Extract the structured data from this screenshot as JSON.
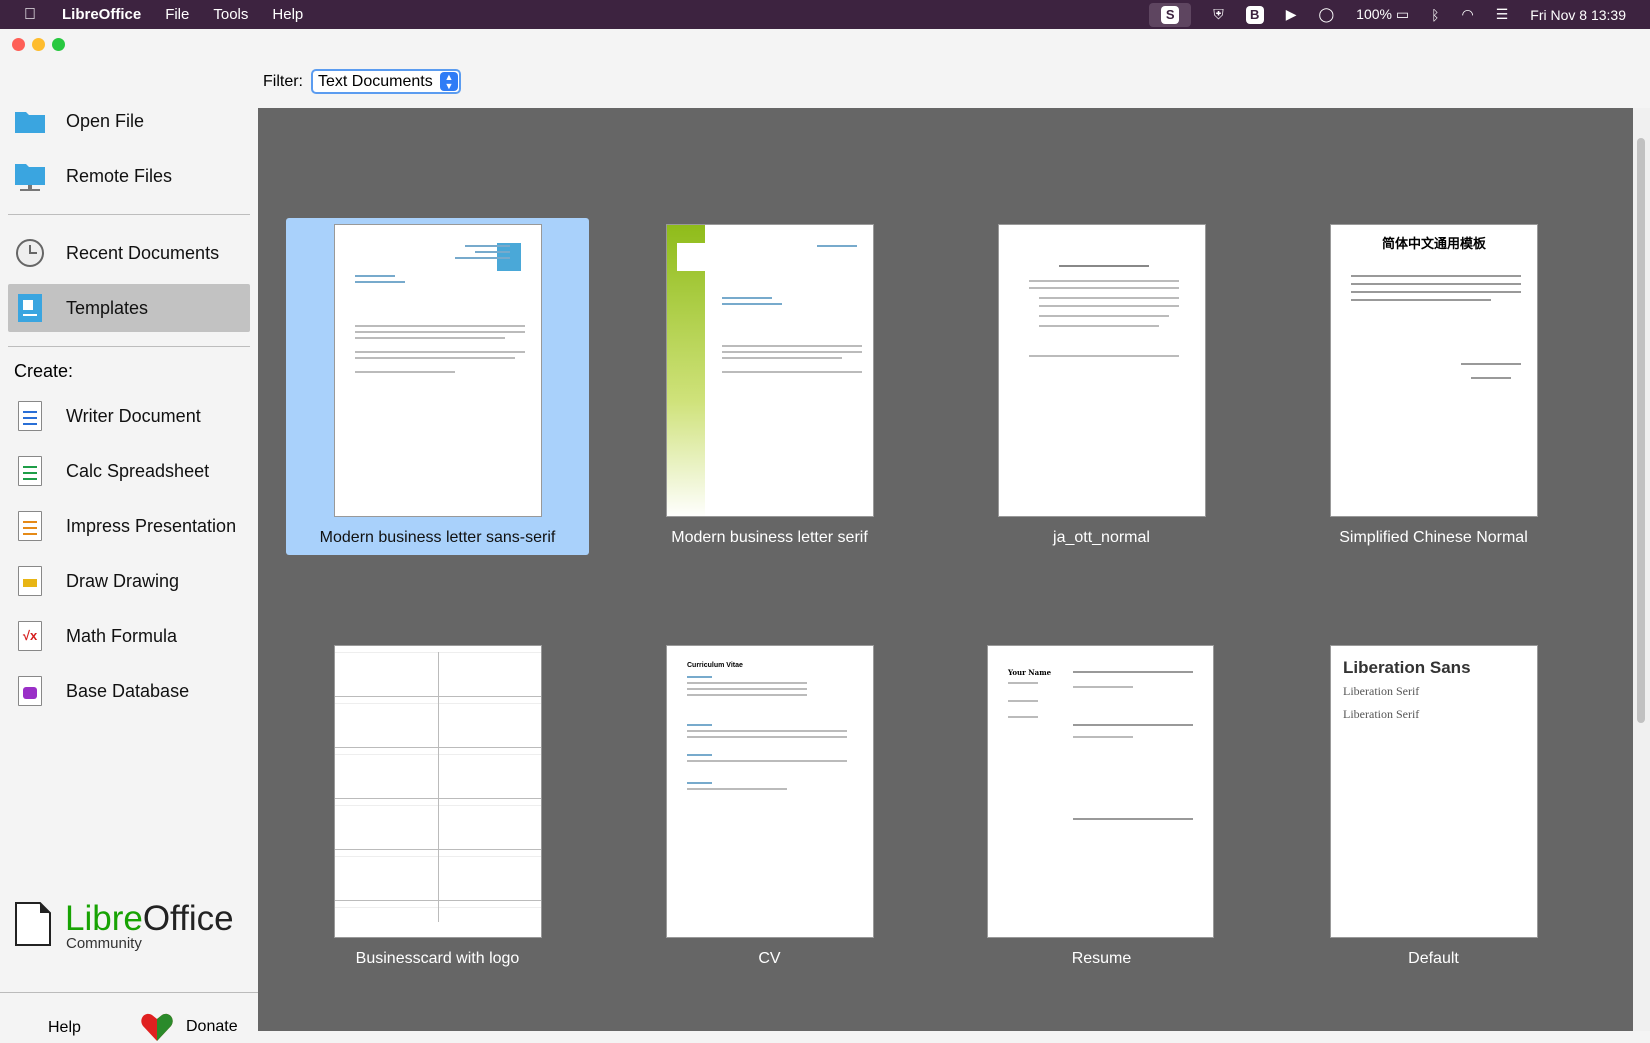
{
  "menubar": {
    "app": "LibreOffice",
    "items": [
      "File",
      "Tools",
      "Help"
    ],
    "status_icons": [
      "s-icon",
      "shield-icon",
      "b-icon",
      "play-icon",
      "circle-icon",
      "battery-icon",
      "bluetooth-icon",
      "wifi-icon",
      "control-center-icon"
    ],
    "battery": "100%",
    "datetime": "Fri Nov 8  13:39"
  },
  "sidebar": {
    "open_file": "Open File",
    "remote_files": "Remote Files",
    "recent": "Recent Documents",
    "templates": "Templates",
    "create_label": "Create:",
    "create": [
      {
        "label": "Writer Document",
        "color": "#2a6fd6"
      },
      {
        "label": "Calc Spreadsheet",
        "color": "#1e9e48"
      },
      {
        "label": "Impress Presentation",
        "color": "#e58a17"
      },
      {
        "label": "Draw Drawing",
        "color": "#e8b514"
      },
      {
        "label": "Math Formula",
        "color": "#d61e1e"
      },
      {
        "label": "Base Database",
        "color": "#9a2fc7"
      }
    ],
    "logo": {
      "libre": "Libre",
      "office": "Office",
      "sub": "Community"
    },
    "help": "Help",
    "donate": "Donate"
  },
  "filter": {
    "label": "Filter:",
    "value": "Text Documents"
  },
  "templates": [
    {
      "name": "Modern business letter sans-serif",
      "selected": true
    },
    {
      "name": "Modern business letter serif"
    },
    {
      "name": "ja_ott_normal"
    },
    {
      "name": "Simplified Chinese Normal",
      "title": "简体中文通用模板"
    },
    {
      "name": "Businesscard with logo"
    },
    {
      "name": "CV",
      "title": "Curriculum Vitae"
    },
    {
      "name": "Resume",
      "title": "Your Name"
    },
    {
      "name": "Default",
      "lines": [
        "Liberation Sans",
        "Liberation Serif",
        "Liberation Serif"
      ]
    }
  ]
}
